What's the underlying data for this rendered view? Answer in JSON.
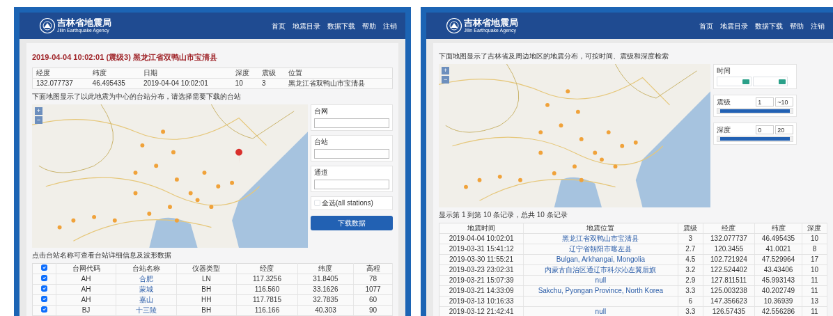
{
  "left_page": {
    "logo": {
      "title": "吉林省地震局",
      "subtitle": "Jilin Earthquake Agency"
    },
    "nav": [
      {
        "label": "首页"
      },
      {
        "label": "地震目录"
      },
      {
        "label": "数据下载"
      },
      {
        "label": "帮助"
      },
      {
        "label": "注销"
      }
    ],
    "event_title": {
      "time": "2019-04-04 10:02:01",
      "magnitude": "(震级3)",
      "location": "黑龙江省双鸭山市宝清县"
    },
    "info_table": {
      "columns": [
        "经度",
        "纬度",
        "日期",
        "深度",
        "震级",
        "位置"
      ],
      "row": [
        "132.077737",
        "46.495435",
        "2019-04-04 10:02:01",
        "10",
        "3",
        "黑龙江省双鸭山市宝清县"
      ]
    },
    "map_note": "下面地图显示了以此地震为中心的台站分布，请选择需要下载的台站",
    "map_zoom": [
      "+",
      "−"
    ],
    "form_fields": [
      {
        "label": "台网"
      },
      {
        "label": "台站"
      },
      {
        "label": "通道"
      }
    ],
    "select_all": {
      "label": "全选(all stations)",
      "checked": false
    },
    "download_button": "下载数据",
    "table_note": "点击台站名称可查看台站详细信息及波形数据",
    "station_table": {
      "all_checked": true,
      "columns": [
        "台网代码",
        "台站名称",
        "仪器类型",
        "经度",
        "纬度",
        "高程"
      ],
      "rows": [
        {
          "checked": true,
          "cells": [
            "AH",
            "合肥",
            "LN",
            "117.3256",
            "31.8405",
            "78"
          ]
        },
        {
          "checked": true,
          "cells": [
            "AH",
            "蒙城",
            "BH",
            "116.560",
            "33.1626",
            "1077"
          ]
        },
        {
          "checked": true,
          "cells": [
            "AH",
            "嘉山",
            "HH",
            "117.7815",
            "32.7835",
            "60"
          ]
        },
        {
          "checked": true,
          "cells": [
            "BJ",
            "十三陵",
            "BH",
            "116.166",
            "40.303",
            "90"
          ]
        }
      ]
    }
  },
  "right_page": {
    "logo": {
      "title": "吉林省地震局",
      "subtitle": "Jilin Earthquake Agency"
    },
    "nav": [
      {
        "label": "首页"
      },
      {
        "label": "地震目录"
      },
      {
        "label": "数据下载"
      },
      {
        "label": "帮助"
      },
      {
        "label": "注销"
      }
    ],
    "search_note": "下面地图显示了吉林省及周边地区的地震分布，可按时间、震级和深度检索",
    "map_zoom": [
      "+",
      "−"
    ],
    "filters": [
      {
        "kind": "date",
        "label": "时间"
      },
      {
        "kind": "range",
        "label": "震级",
        "min": "1",
        "max": "~10",
        "level": 1
      },
      {
        "kind": "range",
        "label": "深度",
        "min": "0",
        "max": "20",
        "level": 1
      }
    ],
    "summary": "显示第 1 到第 10 条记录，总共 10 条记录",
    "quake_table": {
      "columns": [
        "地震时间",
        "地震位置",
        "震级",
        "经度",
        "纬度",
        "深度"
      ],
      "rows": [
        {
          "time": "2019-04-04 10:02:01",
          "location": "黑龙江省双鸭山市宝清县",
          "magnitude": "3",
          "longitude": "132.077737",
          "latitude": "46.495435",
          "depth": "10"
        },
        {
          "time": "2019-03-31 15:41:12",
          "location": "辽宁省朝阳市喀左县",
          "magnitude": "2.7",
          "longitude": "120.3455",
          "latitude": "41.0021",
          "depth": "8"
        },
        {
          "time": "2019-03-30 11:55:21",
          "location": "Bulgan, Arkhangai, Mongolia",
          "magnitude": "4.5",
          "longitude": "102.721924",
          "latitude": "47.529964",
          "depth": "17"
        },
        {
          "time": "2019-03-23 23:02:31",
          "location": "内蒙古自治区通辽市科尔沁左翼后旗",
          "magnitude": "3.2",
          "longitude": "122.524402",
          "latitude": "43.43406",
          "depth": "10"
        },
        {
          "time": "2019-03-21 15:07:39",
          "location": "null",
          "magnitude": "2.9",
          "longitude": "127.811511",
          "latitude": "45.993143",
          "depth": "11"
        },
        {
          "time": "2019-03-21 14:33:09",
          "location": "Sakchu, Pyongan Province, North Korea",
          "magnitude": "3.3",
          "longitude": "125.003238",
          "latitude": "40.202749",
          "depth": "11"
        },
        {
          "time": "2019-03-13 10:16:33",
          "magnitude": "6",
          "longitude": "147.356623",
          "latitude": "10.36939",
          "depth": "13"
        },
        {
          "time": "2019-03-12 21:42:41",
          "location": "null",
          "magnitude": "3.3",
          "longitude": "126.57435",
          "latitude": "42.556286",
          "depth": "11"
        }
      ]
    }
  }
}
